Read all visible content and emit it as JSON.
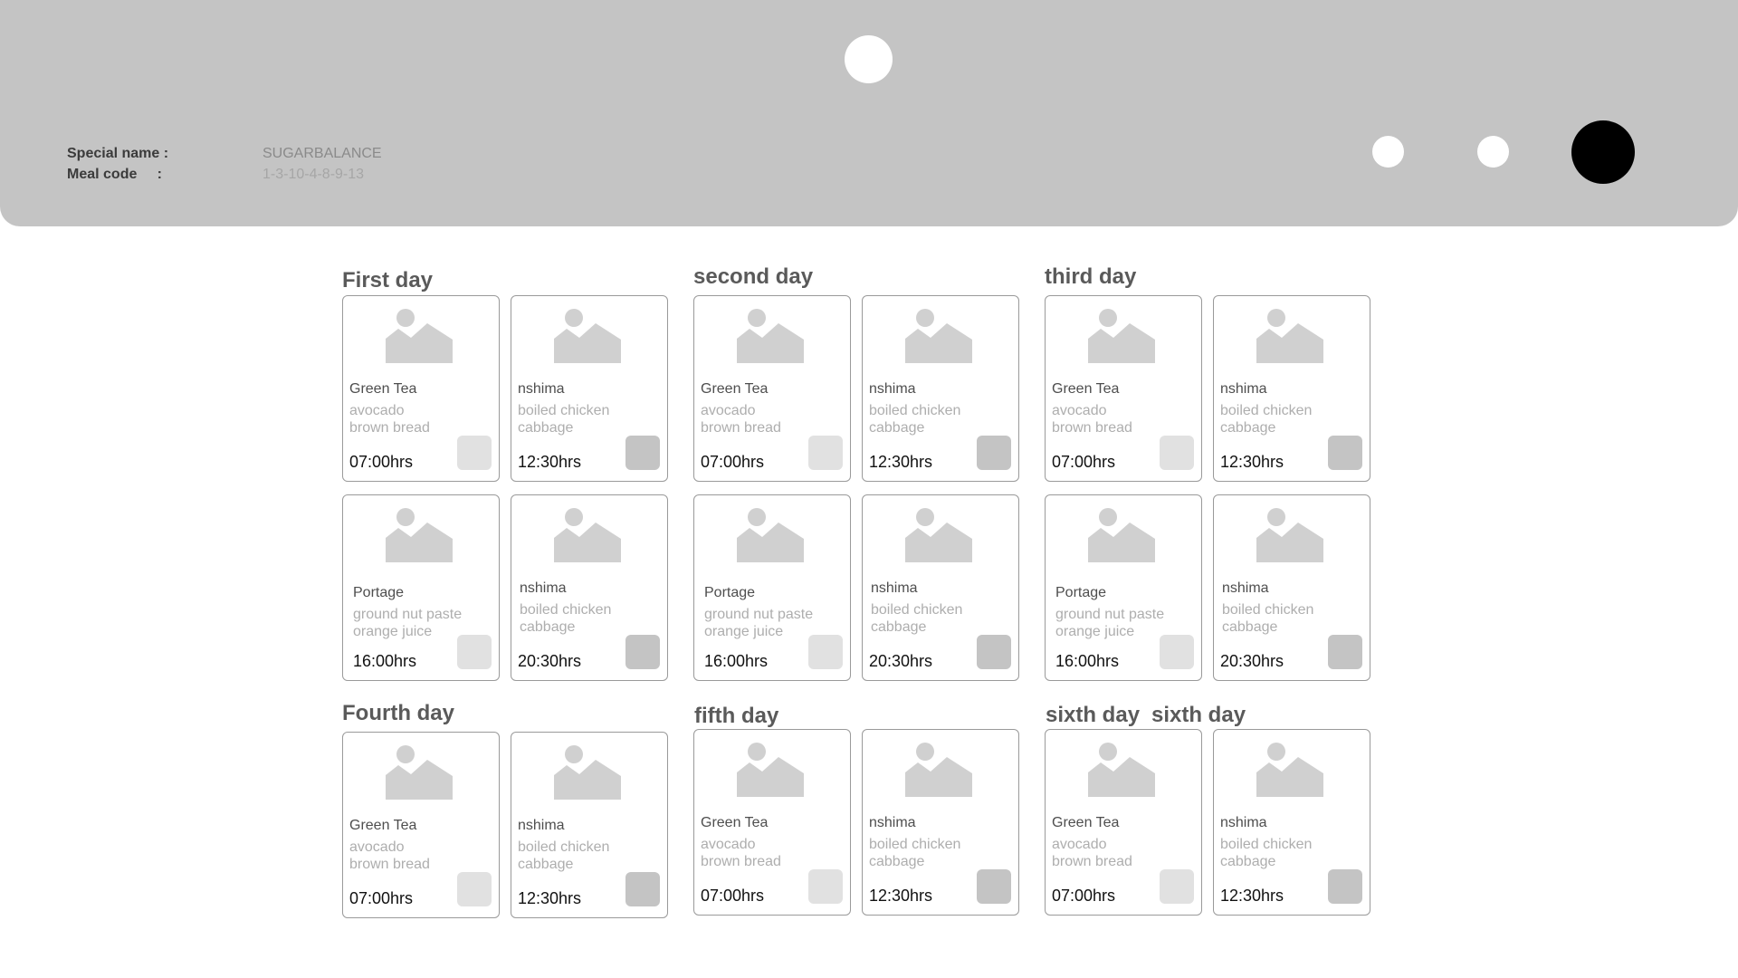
{
  "header": {
    "special_name_label": "Special name :",
    "special_name_value": "SUGARBALANCE",
    "meal_code_label": "Meal code     :",
    "meal_code_value": "1-3-10-4-8-9-13"
  },
  "days": [
    {
      "title": "First day",
      "meals": [
        {
          "name": "Green Tea",
          "ing1": "avocado",
          "ing2": "brown bread",
          "time": "07:00hrs",
          "check": "light"
        },
        {
          "name": "nshima",
          "ing1": "boiled chicken",
          "ing2": "cabbage",
          "time": "12:30hrs",
          "check": "dark"
        },
        {
          "name": "Portage",
          "ing1": "ground nut paste",
          "ing2": "orange juice",
          "time": "16:00hrs",
          "check": "light"
        },
        {
          "name": "nshima",
          "ing1": "boiled chicken",
          "ing2": "cabbage",
          "time": "20:30hrs",
          "check": "dark"
        }
      ]
    },
    {
      "title": "second day",
      "meals": [
        {
          "name": "Green Tea",
          "ing1": "avocado",
          "ing2": "brown bread",
          "time": "07:00hrs",
          "check": "light"
        },
        {
          "name": "nshima",
          "ing1": "boiled chicken",
          "ing2": "cabbage",
          "time": "12:30hrs",
          "check": "dark"
        },
        {
          "name": "Portage",
          "ing1": "ground nut paste",
          "ing2": "orange juice",
          "time": "16:00hrs",
          "check": "light"
        },
        {
          "name": "nshima",
          "ing1": "boiled chicken",
          "ing2": "cabbage",
          "time": "20:30hrs",
          "check": "dark"
        }
      ]
    },
    {
      "title": "third day",
      "meals": [
        {
          "name": "Green Tea",
          "ing1": "avocado",
          "ing2": "brown bread",
          "time": "07:00hrs",
          "check": "light"
        },
        {
          "name": "nshima",
          "ing1": "boiled chicken",
          "ing2": "cabbage",
          "time": "12:30hrs",
          "check": "dark"
        },
        {
          "name": "Portage",
          "ing1": "ground nut paste",
          "ing2": "orange juice",
          "time": "16:00hrs",
          "check": "light"
        },
        {
          "name": "nshima",
          "ing1": "boiled chicken",
          "ing2": "cabbage",
          "time": "20:30hrs",
          "check": "dark"
        }
      ]
    },
    {
      "title": "Fourth day",
      "meals": [
        {
          "name": "Green Tea",
          "ing1": "avocado",
          "ing2": "brown bread",
          "time": "07:00hrs",
          "check": "light"
        },
        {
          "name": "nshima",
          "ing1": "boiled chicken",
          "ing2": "cabbage",
          "time": "12:30hrs",
          "check": "dark"
        }
      ]
    },
    {
      "title": "fifth day",
      "meals": [
        {
          "name": "Green Tea",
          "ing1": "avocado",
          "ing2": "brown bread",
          "time": "07:00hrs",
          "check": "light"
        },
        {
          "name": "nshima",
          "ing1": "boiled chicken",
          "ing2": "cabbage",
          "time": "12:30hrs",
          "check": "dark"
        }
      ]
    },
    {
      "title": "sixth day",
      "title2": "sixth day",
      "meals": [
        {
          "name": "Green Tea",
          "ing1": "avocado",
          "ing2": "brown bread",
          "time": "07:00hrs",
          "check": "light"
        },
        {
          "name": "nshima",
          "ing1": "boiled chicken",
          "ing2": "cabbage",
          "time": "12:30hrs",
          "check": "dark"
        }
      ]
    }
  ],
  "colors": {
    "header_bg": "#c4c4c4",
    "card_border": "#9a9a9a",
    "check_light": "#e1e1e1",
    "check_dark": "#c4c4c4"
  }
}
